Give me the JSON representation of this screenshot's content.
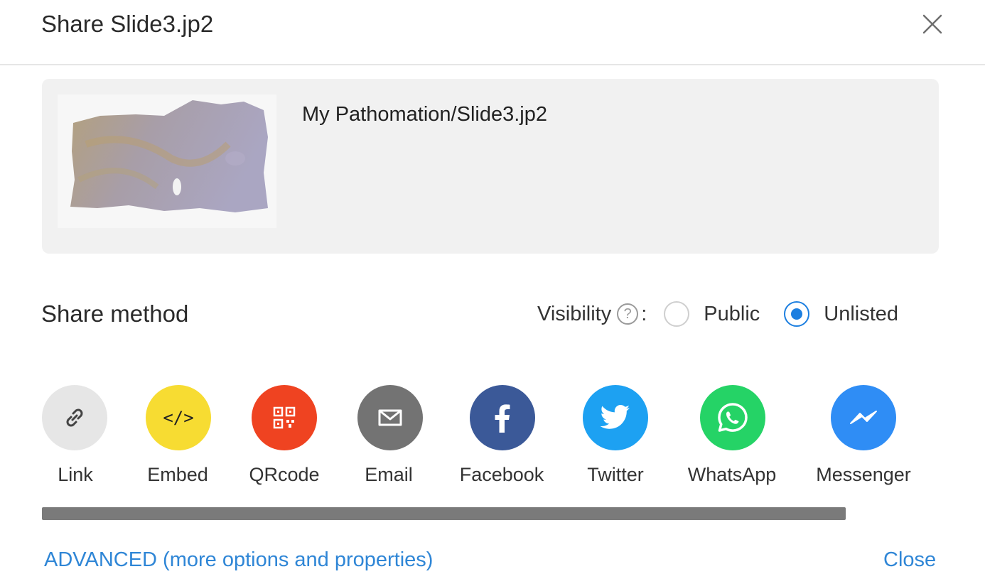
{
  "dialog": {
    "title": "Share Slide3.jp2",
    "close_icon": "close-icon"
  },
  "preview": {
    "path": "My Pathomation/Slide3.jp2"
  },
  "share": {
    "heading": "Share method",
    "visibility_label": "Visibility",
    "help_glyph": "?",
    "colon": ":",
    "options": [
      {
        "label": "Public",
        "selected": false
      },
      {
        "label": "Unlisted",
        "selected": true
      }
    ],
    "methods": [
      {
        "label": "Link",
        "icon": "link-icon",
        "color": "#e6e6e6"
      },
      {
        "label": "Embed",
        "icon": "code-icon",
        "color": "#f7dc32"
      },
      {
        "label": "QRcode",
        "icon": "qrcode-icon",
        "color": "#ef4321"
      },
      {
        "label": "Email",
        "icon": "email-icon",
        "color": "#737373"
      },
      {
        "label": "Facebook",
        "icon": "facebook-icon",
        "color": "#3b5998"
      },
      {
        "label": "Twitter",
        "icon": "twitter-icon",
        "color": "#1da1f2"
      },
      {
        "label": "WhatsApp",
        "icon": "whatsapp-icon",
        "color": "#25d366"
      },
      {
        "label": "Messenger",
        "icon": "messenger-icon",
        "color": "#2f8df5"
      }
    ]
  },
  "footer": {
    "advanced": "ADVANCED (more options and properties)",
    "close": "Close"
  },
  "colors": {
    "accent": "#2f86d6",
    "radio_selected": "#1d7fe0"
  }
}
